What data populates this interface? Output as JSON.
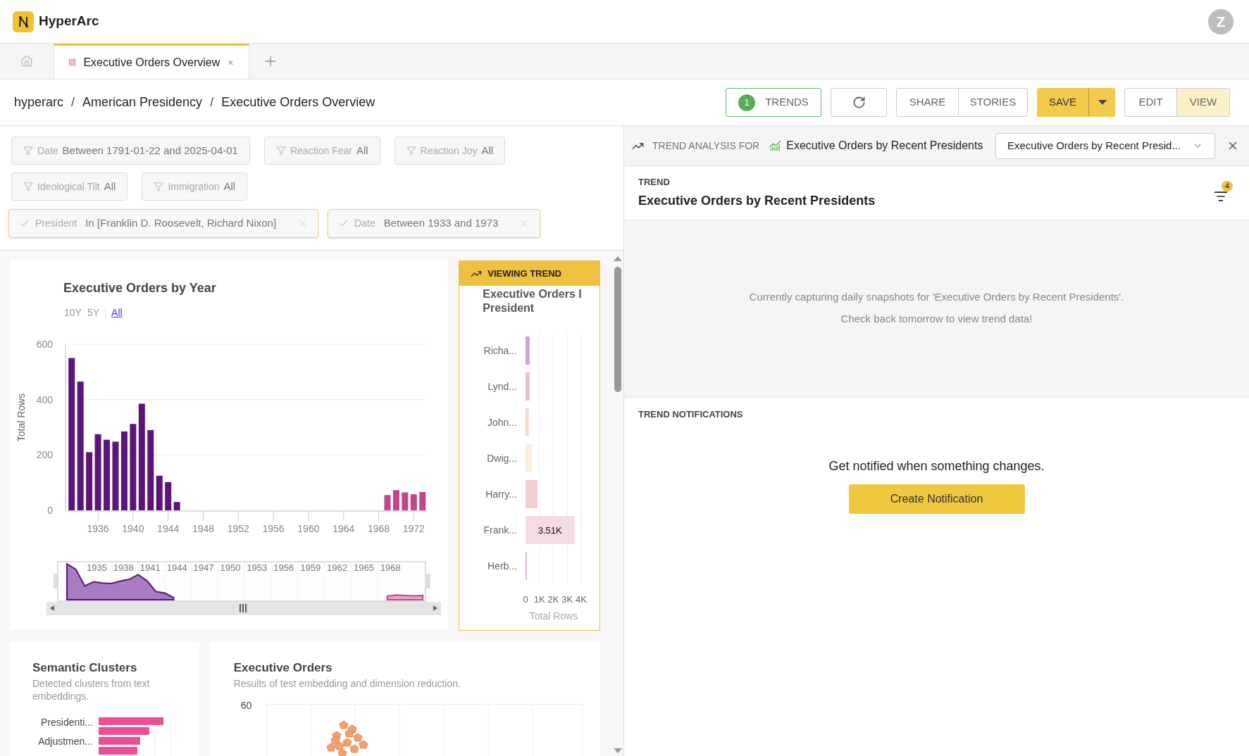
{
  "app": {
    "name": "HyperArc",
    "avatar": "Z"
  },
  "tabs": [
    {
      "label": "Executive Orders Overview",
      "selected": true
    }
  ],
  "breadcrumbs": [
    {
      "kind": "link",
      "text": "hyperarc"
    },
    {
      "kind": "separator",
      "text": "/"
    },
    {
      "kind": "link",
      "text": "American Presidency"
    },
    {
      "kind": "separator",
      "text": "/"
    },
    {
      "kind": "link",
      "text": "Executive Orders Overview"
    }
  ],
  "toolbar": {
    "trends_count": "1",
    "trends": "TRENDS",
    "share": "SHARE",
    "stories": "STORIES",
    "save": "SAVE",
    "modes": [
      {
        "label": "EDIT",
        "selected": false
      },
      {
        "label": "VIEW",
        "selected": true
      }
    ]
  },
  "filters": [
    {
      "field": "Date",
      "value": "Between 1791-01-22 and 2025-04-01",
      "applied": false
    },
    {
      "field": "Reaction Fear",
      "value": "All",
      "applied": false
    },
    {
      "field": "Reaction Joy",
      "value": "All",
      "applied": false
    },
    {
      "field": "Ideological Tilt",
      "value": "All",
      "applied": false
    },
    {
      "field": "Immigration",
      "value": "All",
      "applied": false
    },
    {
      "field": "President",
      "value": "In [Franklin D. Roosevelt, Richard Nixon]",
      "applied": true
    },
    {
      "field": "Date",
      "value": "Between 1933 and 1973",
      "applied": true
    }
  ],
  "year_chart": {
    "title": "Executive Orders by Year",
    "ranges": [
      {
        "label": "10Y",
        "selected": false
      },
      {
        "label": "5Y",
        "selected": false
      },
      {
        "label": "All",
        "selected": true
      }
    ],
    "chart_data": {
      "type": "bar",
      "grid": true,
      "ylabel": "Total Rows",
      "x": [
        1933,
        1934,
        1935,
        1936,
        1937,
        1938,
        1939,
        1940,
        1941,
        1942,
        1943,
        1944,
        1945,
        1969,
        1970,
        1971,
        1972,
        1973
      ],
      "series": [
        {
          "color": "#5c1576",
          "values": [
            550,
            465,
            210,
            275,
            255,
            248,
            285,
            312,
            385,
            290,
            125,
            102,
            30,
            null,
            null,
            null,
            null,
            null
          ]
        },
        {
          "color": "#c2478a",
          "values": [
            null,
            null,
            null,
            null,
            null,
            null,
            null,
            null,
            null,
            null,
            null,
            null,
            null,
            55,
            73,
            65,
            58,
            66
          ]
        }
      ],
      "xlim": [
        1932.3,
        1973.5
      ],
      "ylim": [
        0,
        600
      ],
      "yticks": [
        0,
        200,
        400,
        600
      ],
      "xticks": [
        1936,
        1940,
        1944,
        1948,
        1952,
        1956,
        1960,
        1964,
        1968,
        1972
      ]
    },
    "navigator_labels": [
      "1935",
      "1938",
      "1941",
      "1944",
      "1947",
      "1950",
      "1953",
      "1956",
      "1959",
      "1962",
      "1965",
      "1968"
    ]
  },
  "president_chart": {
    "banner": "VIEWING TREND",
    "title_lines": [
      "Executive Orders I",
      "President"
    ],
    "chart_data": {
      "type": "bar",
      "orientation": "horizontal",
      "grid": true,
      "xlabel": "Total Rows",
      "categories": [
        "Richa...",
        "Lynd...",
        "John...",
        "Dwig...",
        "Harry...",
        "Frank...",
        "Herb..."
      ],
      "series": [
        {
          "color": "#c9a8d8",
          "values": [
            300,
            null,
            null,
            null,
            null,
            null,
            null
          ]
        },
        {
          "color": "#e8c0dc",
          "values": [
            null,
            300,
            null,
            null,
            null,
            null,
            null
          ]
        },
        {
          "color": "#f8d8cc",
          "values": [
            null,
            null,
            230,
            null,
            null,
            null,
            null
          ]
        },
        {
          "color": "#fbeedd",
          "values": [
            null,
            null,
            null,
            470,
            null,
            null,
            null
          ]
        },
        {
          "color": "#f2cdd2",
          "values": [
            null,
            null,
            null,
            null,
            860,
            null,
            null
          ]
        },
        {
          "color": "#f5dbe4",
          "values": [
            null,
            null,
            null,
            null,
            null,
            3510,
            null
          ]
        },
        {
          "color": "#d8b0d8",
          "values": [
            null,
            null,
            null,
            null,
            null,
            null,
            90
          ]
        }
      ],
      "xlim": [
        0,
        4000
      ],
      "xticks": [
        {
          "value": 0,
          "label": "0"
        },
        {
          "value": 1000,
          "label": "1K"
        },
        {
          "value": 2000,
          "label": "2K"
        },
        {
          "value": 3000,
          "label": "3K"
        },
        {
          "value": 4000,
          "label": "4K"
        }
      ],
      "value_labels": [
        null,
        null,
        null,
        null,
        null,
        "3.51K",
        null
      ]
    }
  },
  "clusters": {
    "title": "Semantic Clusters",
    "subtitle": "Detected clusters from text embeddings.",
    "labels": [
      "Presidenti...",
      "Adjustmen..."
    ]
  },
  "orders": {
    "title": "Executive Orders",
    "subtitle": "Results of test embedding and dimension reduction.",
    "y_tick": "60"
  },
  "trend_panel": {
    "heading": "TREND ANALYSIS FOR",
    "subject": "Executive Orders by Recent Presidents",
    "select_value": "Executive Orders by Recent Presid...",
    "trend_label": "TREND",
    "trend_title": "Executive Orders by Recent Presidents",
    "filter_count": "4",
    "empty_lines": [
      "Currently capturing daily snapshots for 'Executive Orders by Recent Presidents'.",
      "Check back tomorrow to view trend data!"
    ],
    "notifications_label": "TREND NOTIFICATIONS",
    "notify_text": "Get notified when something changes.",
    "notify_button": "Create Notification"
  }
}
